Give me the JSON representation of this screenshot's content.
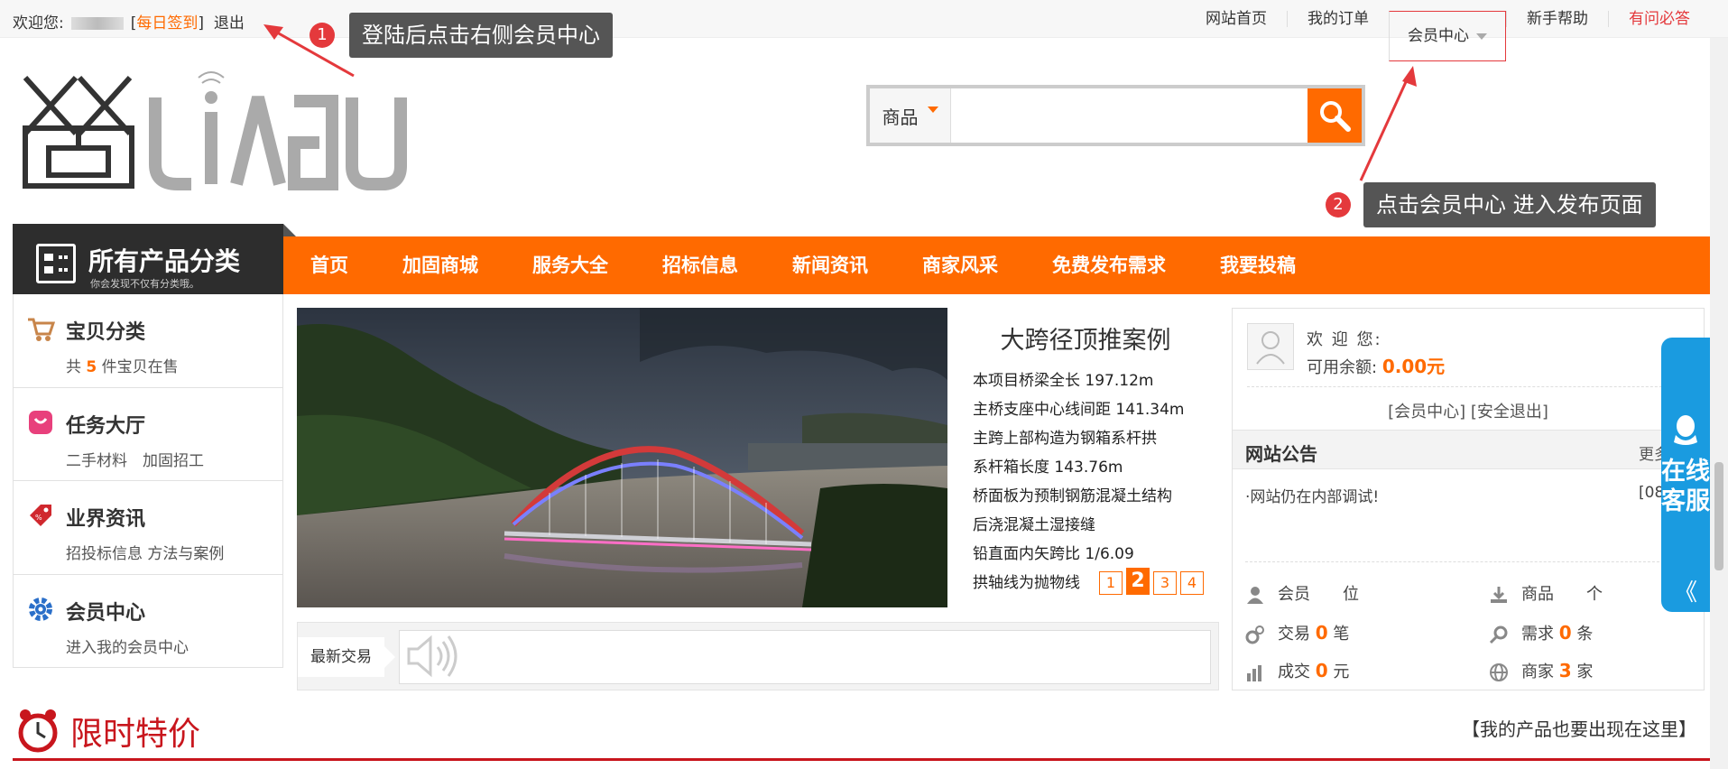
{
  "topbar": {
    "welcome": "欢迎您:",
    "checkin": "每日签到",
    "logout": "退出",
    "nav": [
      "网站首页",
      "我的订单",
      "会员中心",
      "新手帮助",
      "有问必答"
    ]
  },
  "tips": {
    "tip1_num": "1",
    "tip1_text": "登陆后点击右侧会员中心",
    "tip2_num": "2",
    "tip2_text": "点击会员中心 进入发布页面"
  },
  "search": {
    "category": "商品",
    "placeholder": ""
  },
  "allcat": {
    "title": "所有产品分类",
    "subtitle": "你会发现不仅有分类哦。"
  },
  "nav": [
    "首页",
    "加固商城",
    "服务大全",
    "招标信息",
    "新闻资讯",
    "商家风采",
    "免费发布需求",
    "我要投稿"
  ],
  "sidebar": [
    {
      "title": "宝贝分类",
      "sub_pre": "共 ",
      "sub_num": "5",
      "sub_post": " 件宝贝在售"
    },
    {
      "title": "任务大厅",
      "sub": "二手材料　加固招工"
    },
    {
      "title": "业界资讯",
      "sub": "招投标信息 方法与案例"
    },
    {
      "title": "会员中心",
      "sub": "进入我的会员中心"
    }
  ],
  "banner": {
    "title": "大跨径顶推案例",
    "lines": [
      "本项目桥梁全长 197.12m",
      "主桥支座中心线间距 141.34m",
      "主跨上部构造为钢箱系杆拱",
      "系杆箱长度 143.76m",
      "桥面板为预制钢筋混凝土结构",
      "后浇混凝土湿接缝",
      "铅直面内矢跨比 1/6.09",
      "拱轴线为抛物线"
    ],
    "pages": [
      "1",
      "2",
      "3",
      "4"
    ],
    "active_page": 2
  },
  "trade": {
    "label": "最新交易"
  },
  "user": {
    "welcome": "欢 迎 您:",
    "balance_label": "可用余额:",
    "balance": "0.00元",
    "links": "[会员中心] [安全退出]"
  },
  "notice": {
    "title": "网站公告",
    "more": "更多",
    "items": [
      {
        "text": "·网站仍在内部调试!",
        "date": "[08"
      }
    ]
  },
  "stats": {
    "member": {
      "pre": "会员　　",
      "num": "",
      "post": "位"
    },
    "product": {
      "pre": "商品　　",
      "num": "",
      "post": "个"
    },
    "trade": {
      "pre": "交易 ",
      "num": "0",
      "post": " 笔"
    },
    "demand": {
      "pre": "需求 ",
      "num": "0",
      "post": " 条"
    },
    "deal": {
      "pre": "成交 ",
      "num": "0",
      "post": " 元"
    },
    "merchant": {
      "pre": "商家 ",
      "num": "3",
      "post": " 家"
    }
  },
  "service": {
    "text": "在线客服",
    "arrow": "《"
  },
  "flash": {
    "title": "限时特价",
    "right": "【我的产品也要出现在这里】"
  },
  "colors": {
    "accent": "#ff6a00",
    "red": "#e4393c",
    "dark": "#2d2d2d",
    "service": "#1a9be0"
  }
}
